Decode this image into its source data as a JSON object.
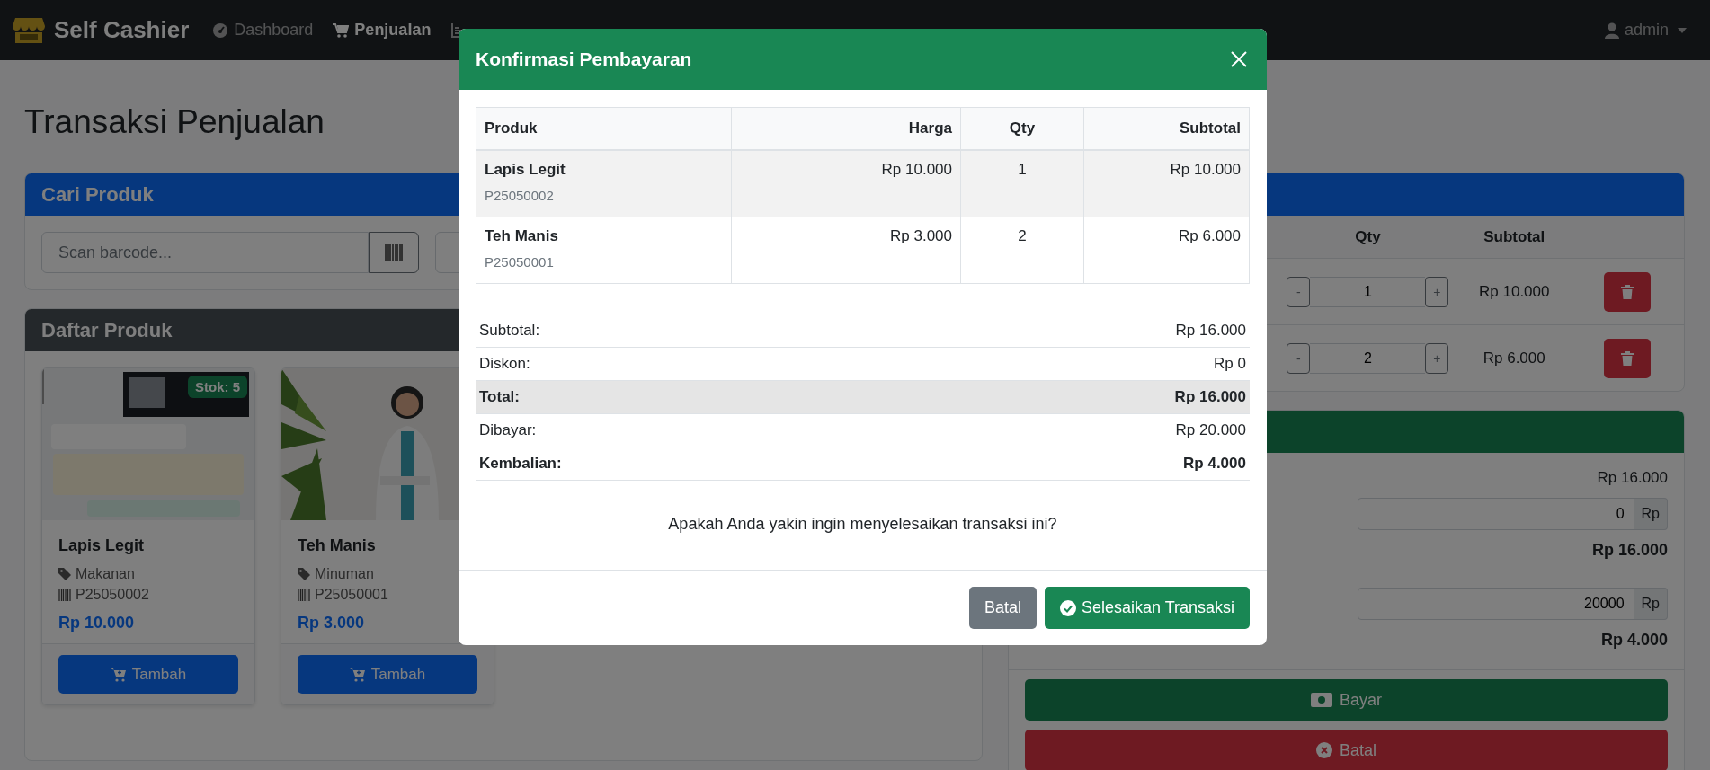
{
  "navbar": {
    "brand": "Self Cashier",
    "items": [
      {
        "label": "Dashboard",
        "selected": false
      },
      {
        "label": "Penjualan",
        "selected": true
      },
      {
        "selected": false
      }
    ],
    "user": "admin"
  },
  "page_title": "Transaksi Penjualan",
  "search_card": {
    "title": "Cari Produk",
    "barcode_placeholder": "Scan barcode..."
  },
  "product_list": {
    "title": "Daftar Produk",
    "products": [
      {
        "name": "Lapis Legit",
        "category": "Makanan",
        "code": "P25050002",
        "price": "Rp 10.000",
        "stock": "Stok: 5",
        "button": "Tambah"
      },
      {
        "name": "Teh Manis",
        "category": "Minuman",
        "code": "P25050001",
        "price": "Rp 3.000",
        "button": "Tambah"
      }
    ]
  },
  "cart": {
    "columns": [
      "Qty",
      "Subtotal"
    ],
    "items": [
      {
        "minus": "-",
        "qty": "1",
        "plus": "+",
        "subtotal": "Rp 10.000"
      },
      {
        "minus": "-",
        "qty": "2",
        "plus": "+",
        "subtotal": "Rp 6.000"
      }
    ]
  },
  "payment": {
    "subtotal": "Rp 16.000",
    "discount": "0",
    "discount_addon": "Rp",
    "total": "Rp 16.000",
    "paid": "20000",
    "paid_addon": "Rp",
    "change": "Rp 4.000",
    "pay_button": "Bayar",
    "cancel_button": "Batal"
  },
  "modal": {
    "title": "Konfirmasi Pembayaran",
    "columns": [
      "Produk",
      "Harga",
      "Qty",
      "Subtotal"
    ],
    "rows": [
      {
        "name": "Lapis Legit",
        "code": "P25050002",
        "price": "Rp 10.000",
        "qty": "1",
        "subtotal": "Rp 10.000"
      },
      {
        "name": "Teh Manis",
        "code": "P25050001",
        "price": "Rp 3.000",
        "qty": "2",
        "subtotal": "Rp 6.000"
      }
    ],
    "summary": [
      {
        "label": "Subtotal:",
        "value": "Rp 16.000",
        "bold": false,
        "shaded": false
      },
      {
        "label": "Diskon:",
        "value": "Rp 0",
        "bold": false,
        "shaded": false
      },
      {
        "label": "Total:",
        "value": "Rp 16.000",
        "bold": true,
        "shaded": true
      },
      {
        "label": "Dibayar:",
        "value": "Rp 20.000",
        "bold": false,
        "shaded": false
      },
      {
        "label": "Kembalian:",
        "value": "Rp 4.000",
        "bold": true,
        "shaded": false
      }
    ],
    "question": "Apakah Anda yakin ingin menyelesaikan transaksi ini?",
    "buttons": [
      {
        "label": "Batal",
        "kind": "secondary"
      },
      {
        "label": "Selesaikan Transaksi",
        "kind": "primary"
      }
    ]
  }
}
